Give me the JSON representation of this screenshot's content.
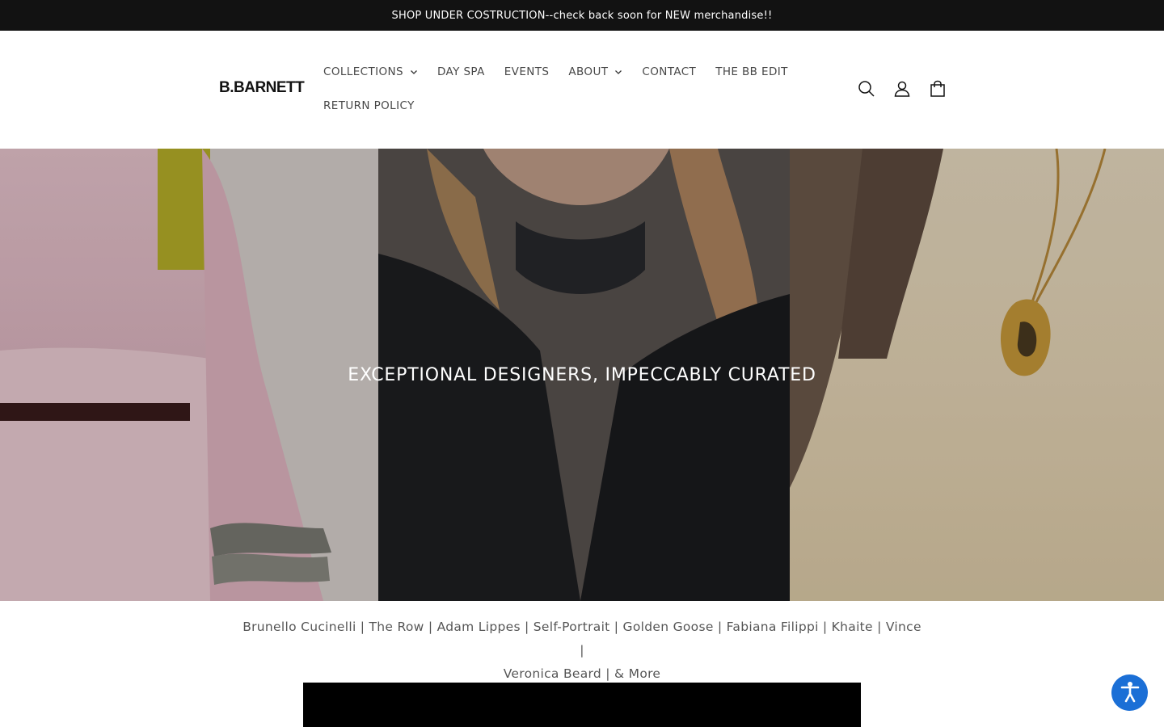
{
  "announcement": {
    "text": "SHOP UNDER COSTRUCTION--check back soon for NEW merchandise!!"
  },
  "header": {
    "logo_text": "B.BARNETT",
    "nav_row1": [
      {
        "label": "COLLECTIONS",
        "has_dropdown": true
      },
      {
        "label": "DAY SPA",
        "has_dropdown": false
      },
      {
        "label": "EVENTS",
        "has_dropdown": false
      },
      {
        "label": "ABOUT",
        "has_dropdown": true
      },
      {
        "label": "CONTACT",
        "has_dropdown": false
      },
      {
        "label": "THE BB EDIT",
        "has_dropdown": false
      }
    ],
    "nav_row2": [
      {
        "label": "RETURN POLICY",
        "has_dropdown": false
      }
    ],
    "icons": [
      "search-icon",
      "account-icon",
      "cart-icon"
    ]
  },
  "hero": {
    "title": "EXCEPTIONAL DESIGNERS, IMPECCABLY CURATED"
  },
  "brands": {
    "line1": "Brunello Cucinelli | The Row | Adam Lippes | Self-Portrait | Golden Goose | Fabiana Filippi | Khaite | Vince |",
    "line2": "Veronica Beard | & More"
  },
  "colors": {
    "announcement_bg": "#121212",
    "accessibility_button": "#1b6fd6"
  }
}
